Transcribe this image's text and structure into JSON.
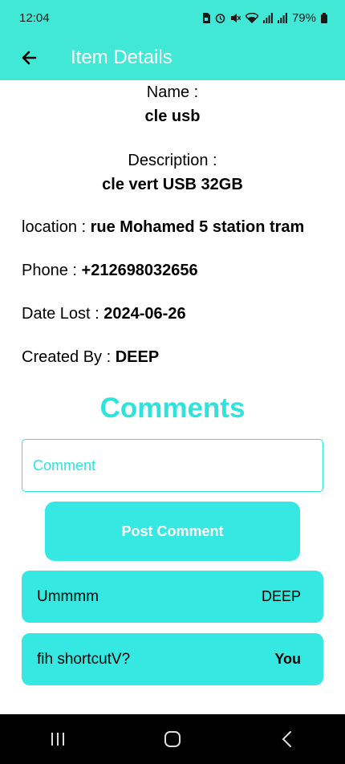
{
  "status_bar": {
    "time": "12:04",
    "battery": "79%",
    "icons": [
      "sim-icon",
      "alarm-icon",
      "mute-icon",
      "wifi-icon",
      "signal-icon",
      "signal-icon",
      "battery-icon"
    ]
  },
  "app_bar": {
    "title": "Item Details",
    "back_icon": "arrow-left-icon"
  },
  "details": {
    "name_label": "Name :",
    "name_value": "cle usb",
    "description_label": "Description :",
    "description_value": "cle vert USB 32GB",
    "location_label": "location : ",
    "location_value": "rue Mohamed 5 station tram",
    "phone_label": "Phone : ",
    "phone_value": "+212698032656",
    "date_label": "Date Lost : ",
    "date_value": "2024-06-26",
    "created_label": "Created By : ",
    "created_value": "DEEP"
  },
  "comments": {
    "title": "Comments",
    "input_placeholder": "Comment",
    "post_button": "Post Comment",
    "items": [
      {
        "text": "Ummmm",
        "author": "DEEP"
      },
      {
        "text": "fih shortcutV?",
        "author": "You"
      }
    ]
  },
  "nav_bar": {
    "buttons": [
      "recent-apps-icon",
      "home-icon",
      "back-icon"
    ]
  },
  "colors": {
    "accent": "#42e8d6",
    "button": "#36e8e2",
    "title_text": "#2ee3dc"
  }
}
